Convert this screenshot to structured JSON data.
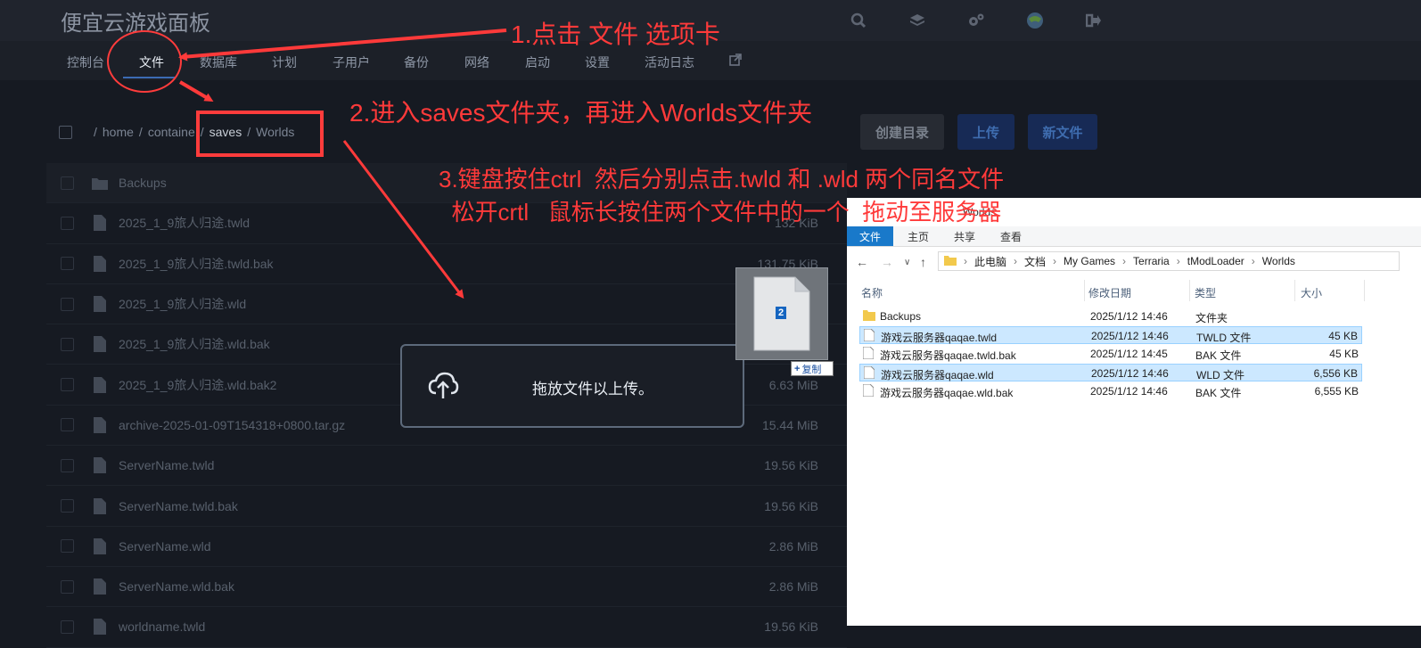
{
  "app": {
    "title": "便宜云游戏面板"
  },
  "nav": {
    "items": [
      "控制台",
      "文件",
      "数据库",
      "计划",
      "子用户",
      "备份",
      "网络",
      "启动",
      "设置",
      "活动日志"
    ]
  },
  "breadcrumb": [
    "/",
    "home",
    "/",
    "containe",
    "/",
    "saves",
    "/",
    "Worlds"
  ],
  "buttons": {
    "create_dir": "创建目录",
    "upload": "上传",
    "new_file": "新文件"
  },
  "files": [
    {
      "name": "Backups",
      "size": "",
      "type": "folder"
    },
    {
      "name": "2025_1_9旅人归途.twld",
      "size": "132 KiB",
      "type": "file"
    },
    {
      "name": "2025_1_9旅人归途.twld.bak",
      "size": "131.75 KiB",
      "type": "file"
    },
    {
      "name": "2025_1_9旅人归途.wld",
      "size": "",
      "type": "file"
    },
    {
      "name": "2025_1_9旅人归途.wld.bak",
      "size": "",
      "type": "file"
    },
    {
      "name": "2025_1_9旅人归途.wld.bak2",
      "size": "6.63 MiB",
      "type": "file"
    },
    {
      "name": "archive-2025-01-09T154318+0800.tar.gz",
      "size": "15.44 MiB",
      "type": "file"
    },
    {
      "name": "ServerName.twld",
      "size": "19.56 KiB",
      "type": "file"
    },
    {
      "name": "ServerName.twld.bak",
      "size": "19.56 KiB",
      "type": "file"
    },
    {
      "name": "ServerName.wld",
      "size": "2.86 MiB",
      "type": "file"
    },
    {
      "name": "ServerName.wld.bak",
      "size": "2.86 MiB",
      "type": "file"
    },
    {
      "name": "worldname.twld",
      "size": "19.56 KiB",
      "type": "file"
    }
  ],
  "dropzone": {
    "text": "拖放文件以上传。"
  },
  "drag": {
    "count": "2",
    "copy_label": "复制"
  },
  "explorer": {
    "title": "Worlds",
    "ribbon_tabs": [
      "文件",
      "主页",
      "共享",
      "查看"
    ],
    "path": [
      "此电脑",
      "文档",
      "My Games",
      "Terraria",
      "tModLoader",
      "Worlds"
    ],
    "columns": [
      "名称",
      "修改日期",
      "类型",
      "大小"
    ],
    "rows": [
      {
        "name": "Backups",
        "date": "2025/1/12 14:46",
        "type": "文件夹",
        "size": "",
        "selected": false,
        "kind": "folder"
      },
      {
        "name": "游戏云服务器qaqae.twld",
        "date": "2025/1/12 14:46",
        "type": "TWLD 文件",
        "size": "45 KB",
        "selected": true,
        "kind": "file"
      },
      {
        "name": "游戏云服务器qaqae.twld.bak",
        "date": "2025/1/12 14:45",
        "type": "BAK 文件",
        "size": "45 KB",
        "selected": false,
        "kind": "file"
      },
      {
        "name": "游戏云服务器qaqae.wld",
        "date": "2025/1/12 14:46",
        "type": "WLD 文件",
        "size": "6,556 KB",
        "selected": true,
        "kind": "file"
      },
      {
        "name": "游戏云服务器qaqae.wld.bak",
        "date": "2025/1/12 14:46",
        "type": "BAK 文件",
        "size": "6,555 KB",
        "selected": false,
        "kind": "file"
      }
    ]
  },
  "annotations": {
    "step1": "1.点击 文件 选项卡",
    "step2": "2.进入saves文件夹，再进入Worlds文件夹",
    "step3": "3.键盘按住ctrl  然后分别点击.twld 和 .wld 两个同名文件\n  松开crtl   鼠标长按住两个文件中的一个  拖动至服务器",
    "color": "#ff3a3a"
  },
  "icons": {
    "top": [
      "search-icon",
      "layers-icon",
      "gears-icon",
      "avatar",
      "logout-icon"
    ]
  }
}
